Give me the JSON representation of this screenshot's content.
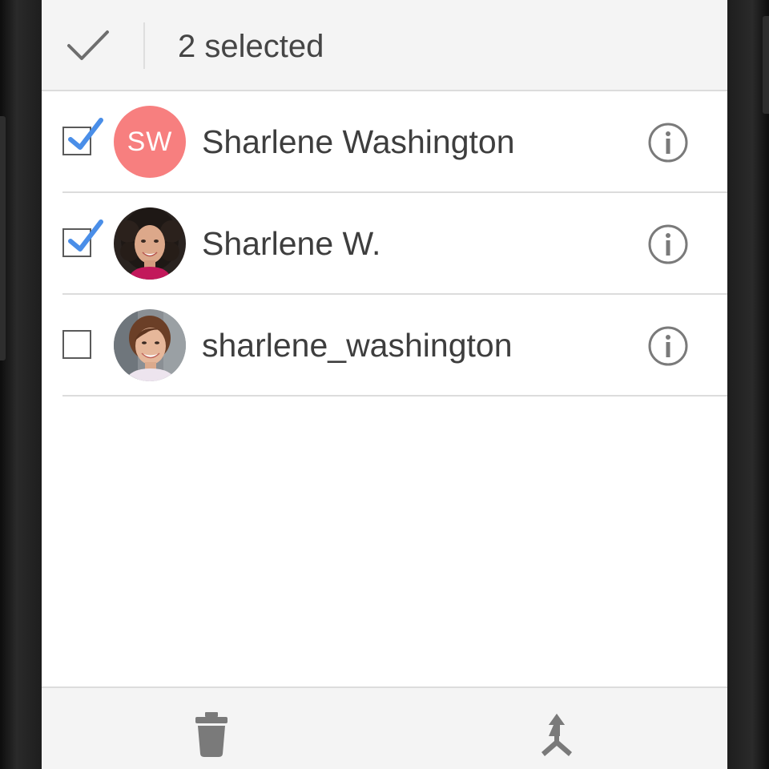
{
  "header": {
    "selected_label": "2 selected",
    "done_icon": "check-icon"
  },
  "contacts": [
    {
      "name": "Sharlene Washington",
      "initials": "SW",
      "avatar": "initials",
      "avatar_color": "#f77f7f",
      "checked": true
    },
    {
      "name": "Sharlene W.",
      "initials": "",
      "avatar": "photo-woman-curly-hair",
      "checked": true
    },
    {
      "name": "sharlene_washington",
      "initials": "",
      "avatar": "photo-woman-smiling",
      "checked": false
    }
  ],
  "row_info_icon": "info-icon",
  "bottom_actions": [
    {
      "icon": "delete-icon"
    },
    {
      "icon": "merge-icon"
    }
  ],
  "colors": {
    "checkmark": "#4a8ee8",
    "icon_gray": "#7a7a7a",
    "text": "#3e3e3e",
    "bar_background": "#f4f4f4"
  }
}
